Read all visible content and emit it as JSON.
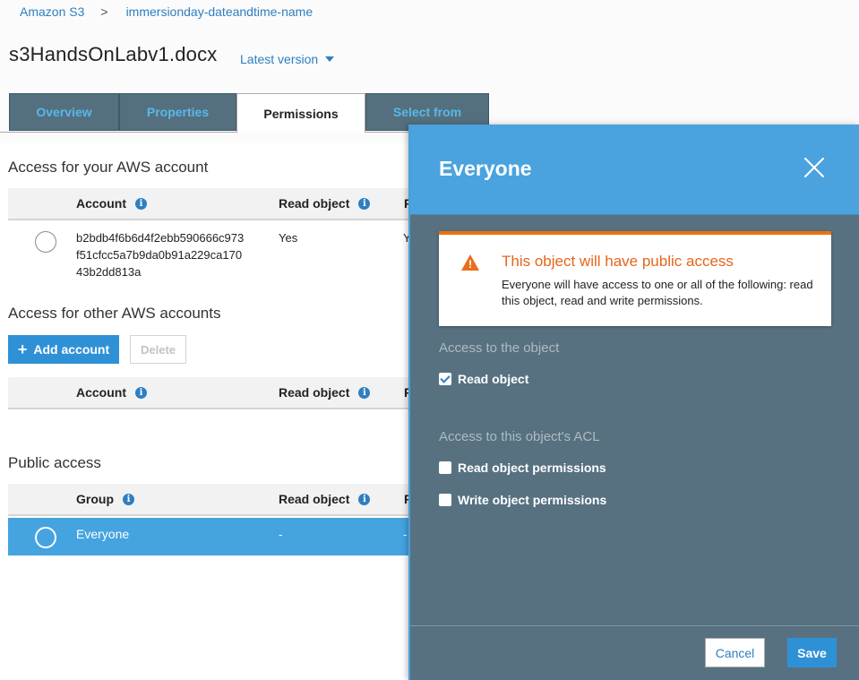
{
  "breadcrumb": {
    "root": "Amazon S3",
    "separator": ">",
    "bucket": "immersionday-dateandtime-name"
  },
  "object": {
    "name": "s3HandsOnLabv1.docx",
    "version_label": "Latest version"
  },
  "tabs": [
    {
      "label": "Overview",
      "active": false
    },
    {
      "label": "Properties",
      "active": false
    },
    {
      "label": "Permissions",
      "active": true
    },
    {
      "label": "Select from",
      "active": false
    }
  ],
  "own_account": {
    "title": "Access for your AWS account",
    "columns": {
      "account": "Account",
      "read_object": "Read object",
      "next_col_initial": "R"
    },
    "row": {
      "account_lines": [
        "b2bdb4f6b6d4f2ebb590666c973",
        "f51cfcc5a7b9da0b91a229ca170",
        "43b2dd813a"
      ],
      "read_object": "Yes",
      "next_col_value": "Y"
    }
  },
  "other_accounts": {
    "title": "Access for other AWS accounts",
    "add_button": "Add account",
    "delete_button": "Delete",
    "columns": {
      "account": "Account",
      "read_object": "Read object",
      "next_col_initial": "R"
    }
  },
  "public_access": {
    "title": "Public access",
    "columns": {
      "group": "Group",
      "read_object": "Read object",
      "next_col_initial": "R"
    },
    "row": {
      "group": "Everyone",
      "read_object": "-",
      "next_col_value": "-"
    }
  },
  "panel": {
    "title": "Everyone",
    "alert": {
      "title": "This object will have public access",
      "body": "Everyone will have access to one or all of the following: read this object, read and write permissions."
    },
    "object_access_label": "Access to the object",
    "read_object": {
      "label": "Read object",
      "checked": true
    },
    "acl_access_label": "Access to this object's ACL",
    "read_permissions": {
      "label": "Read object permissions",
      "checked": false
    },
    "write_permissions": {
      "label": "Write object permissions",
      "checked": false
    },
    "cancel": "Cancel",
    "save": "Save"
  },
  "icons": {
    "info": "i",
    "add": "+",
    "warning": "!"
  },
  "colors": {
    "accent": "#2e91d6",
    "link": "#2e7fc0",
    "warning": "#ec7211",
    "panel": "#577180",
    "panel_header": "#4aa3de"
  }
}
